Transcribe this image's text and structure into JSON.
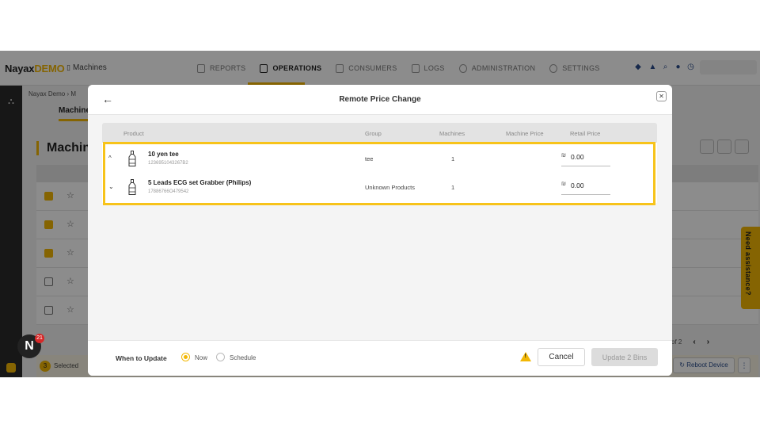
{
  "header": {
    "logo_main": "Nayax",
    "logo_accent": "DEMO",
    "breadcrumb": "Machines",
    "nav": [
      {
        "label": "REPORTS",
        "active": false
      },
      {
        "label": "OPERATIONS",
        "active": true
      },
      {
        "label": "CONSUMERS",
        "active": false
      },
      {
        "label": "LOGS",
        "active": false
      },
      {
        "label": "ADMINISTRATION",
        "active": false
      },
      {
        "label": "SETTINGS",
        "active": false
      }
    ]
  },
  "background": {
    "breadcrumb": "Nayax Demo  ›  M",
    "tab_label": "Machine",
    "page_title": "Machin",
    "selected_count": "3",
    "selected_label": "Selected",
    "pager_text": "of 2",
    "reboot_label": "Reboot Device",
    "notification_count": "21",
    "assistance_label": "Need assistance?"
  },
  "modal": {
    "title": "Remote Price Change",
    "columns": {
      "product": "Product",
      "group": "Group",
      "machines": "Machines",
      "machine_price": "Machine Price",
      "retail_price": "Retail Price"
    },
    "rows": [
      {
        "name": "10 yen tee",
        "code": "1236951043267B2",
        "group": "tee",
        "machines": "1",
        "currency": "₪",
        "price": "0.00",
        "expanded": true
      },
      {
        "name": "5 Leads ECG set Grabber (Philips)",
        "code": "17886766O479542",
        "group": "Unknown Products",
        "machines": "1",
        "currency": "₪",
        "price": "0.00",
        "expanded": false
      }
    ],
    "footer": {
      "when_label": "When to Update",
      "option_now": "Now",
      "option_schedule": "Schedule",
      "cancel_label": "Cancel",
      "update_label": "Update 2 Bins"
    }
  },
  "colors": {
    "accent": "#f2b705",
    "highlight": "#f7c31a"
  }
}
